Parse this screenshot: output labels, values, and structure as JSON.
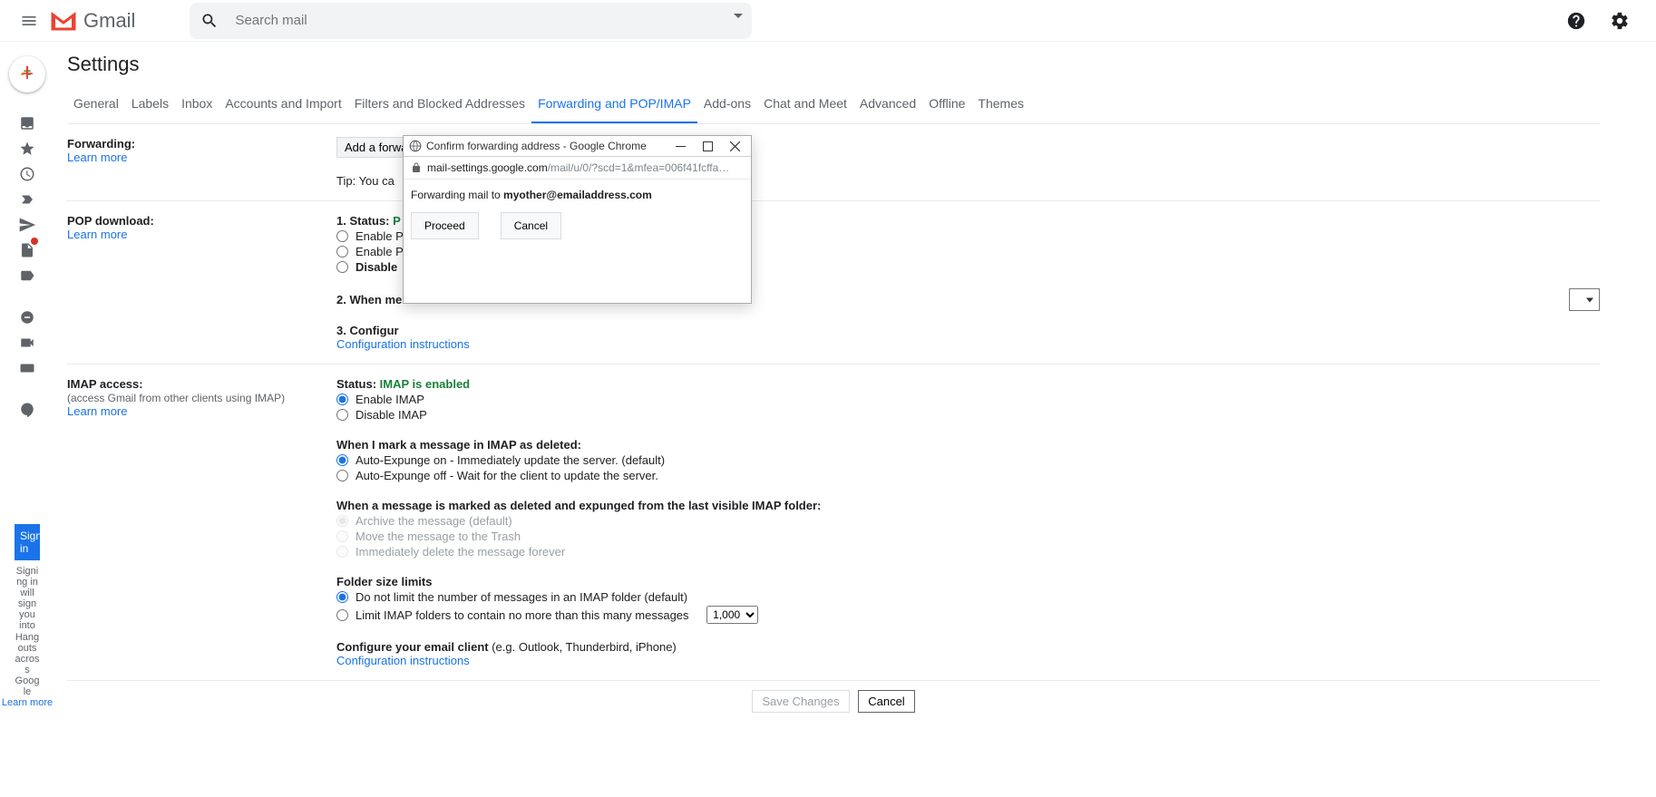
{
  "header": {
    "logo_text": "Gmail",
    "search_placeholder": "Search mail"
  },
  "settings_title": "Settings",
  "tabs": [
    "General",
    "Labels",
    "Inbox",
    "Accounts and Import",
    "Filters and Blocked Addresses",
    "Forwarding and POP/IMAP",
    "Add-ons",
    "Chat and Meet",
    "Advanced",
    "Offline",
    "Themes"
  ],
  "active_tab_index": 5,
  "forwarding": {
    "label": "Forwarding:",
    "learn": "Learn more",
    "add_btn": "Add a forwarding address",
    "tip": "Tip: You ca"
  },
  "pop": {
    "label": "POP download:",
    "learn": "Learn more",
    "status_prefix": "1. Status: ",
    "status_val": "P",
    "opt1": "Enable P",
    "opt2": "Enable P",
    "opt3": "Disable ",
    "when_label": "2. When me",
    "conf_prefix": "3. Configur",
    "conf_link": "Configuration instructions"
  },
  "imap": {
    "label": "IMAP access:",
    "sub": "(access Gmail from other clients using IMAP)",
    "learn": "Learn more",
    "status_prefix": "Status: ",
    "status_val": "IMAP is enabled",
    "enable": "Enable IMAP",
    "disable": "Disable IMAP",
    "deleted_title": "When I mark a message in IMAP as deleted:",
    "expunge_on": "Auto-Expunge on - Immediately update the server. (default)",
    "expunge_off": "Auto-Expunge off - Wait for the client to update the server.",
    "expunged_title": "When a message is marked as deleted and expunged from the last visible IMAP folder:",
    "archive": "Archive the message (default)",
    "trash": "Move the message to the Trash",
    "delforever": "Immediately delete the message forever",
    "folder_title": "Folder size limits",
    "nolimit": "Do not limit the number of messages in an IMAP folder (default)",
    "limit": "Limit IMAP folders to contain no more than this many messages",
    "limit_val": "1,000",
    "conf_prefix": "Configure your email client ",
    "conf_suffix": "(e.g. Outlook, Thunderbird, iPhone)",
    "conf_link": "Configuration instructions"
  },
  "footer": {
    "save": "Save Changes",
    "cancel": "Cancel"
  },
  "popup": {
    "title": "Confirm forwarding address - Google Chrome",
    "url_host": "mail-settings.google.com",
    "url_path": "/mail/u/0/?scd=1&mfea=006f41fcffa…",
    "body_prefix": "Forwarding mail to ",
    "body_email": "myother@emailaddress.com",
    "proceed": "Proceed",
    "cancel": "Cancel"
  },
  "sidebar": {
    "signin": "Sign in",
    "signin_desc": "Signing in will sign you into Hangouts across Google",
    "learn": "Learn more"
  }
}
